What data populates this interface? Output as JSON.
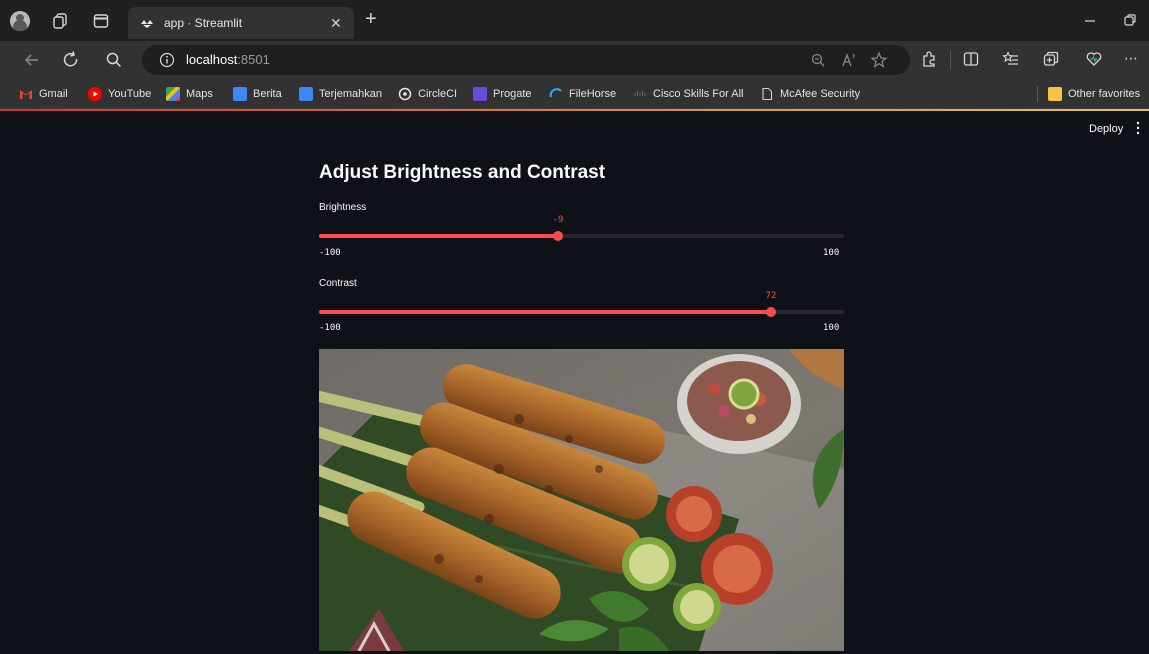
{
  "browser": {
    "tab_title": "app · Streamlit",
    "url_host": "localhost",
    "url_port": ":8501",
    "bookmarks": [
      {
        "label": "Gmail",
        "icon": "gmail-icon",
        "color": "#ea4335"
      },
      {
        "label": "YouTube",
        "icon": "youtube-icon",
        "color": "#ff0000"
      },
      {
        "label": "Maps",
        "icon": "maps-icon",
        "color": "#34a853"
      },
      {
        "label": "Berita",
        "icon": "news-icon",
        "color": "#4285f4"
      },
      {
        "label": "Terjemahkan",
        "icon": "translate-icon",
        "color": "#4285f4"
      },
      {
        "label": "CircleCI",
        "icon": "circleci-icon",
        "color": "#e8e8e8"
      },
      {
        "label": "Progate",
        "icon": "progate-icon",
        "color": "#6b4bdc"
      },
      {
        "label": "FileHorse",
        "icon": "filehorse-icon",
        "color": "#3aa3e3"
      },
      {
        "label": "Cisco Skills For All",
        "icon": "cisco-icon",
        "color": "#555555"
      },
      {
        "label": "McAfee Security",
        "icon": "page-icon",
        "color": "#d0d0d0"
      }
    ],
    "other_favorites": "Other favorites"
  },
  "header": {
    "deploy_label": "Deploy"
  },
  "main": {
    "title": "Adjust Brightness and Contrast",
    "sliders": [
      {
        "label": "Brightness",
        "value": -9,
        "value_text": "-9",
        "min": -100,
        "max": 100,
        "min_text": "-100",
        "max_text": "100"
      },
      {
        "label": "Contrast",
        "value": 72,
        "value_text": "72",
        "min": -100,
        "max": 100,
        "min_text": "-100",
        "max_text": "100"
      }
    ]
  },
  "theme": {
    "accent": "#ff4b4b",
    "background": "#0e1117"
  }
}
